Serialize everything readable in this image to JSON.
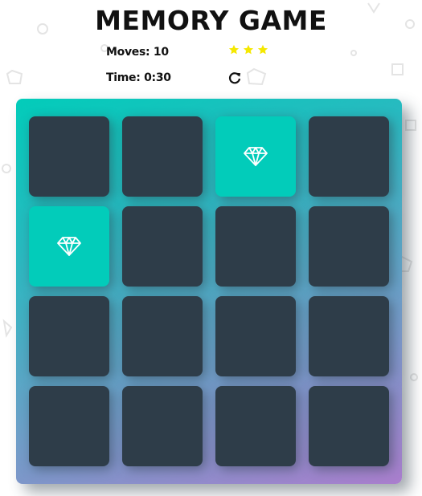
{
  "title": "MEMORY GAME",
  "score_panel": {
    "moves_label": "Moves: 10",
    "time_label": "Time: 0:30",
    "stars_filled": 3,
    "star_icon": "star-icon",
    "restart_icon": "restart-icon",
    "star_color": "#f5e800"
  },
  "deck": {
    "rows": 4,
    "cols": 4,
    "cards": [
      {
        "state": "closed"
      },
      {
        "state": "closed"
      },
      {
        "state": "open",
        "icon": "diamond-icon"
      },
      {
        "state": "closed"
      },
      {
        "state": "open",
        "icon": "diamond-icon"
      },
      {
        "state": "closed"
      },
      {
        "state": "closed"
      },
      {
        "state": "closed"
      },
      {
        "state": "closed"
      },
      {
        "state": "closed"
      },
      {
        "state": "closed"
      },
      {
        "state": "closed"
      },
      {
        "state": "closed"
      },
      {
        "state": "closed"
      },
      {
        "state": "closed"
      },
      {
        "state": "closed"
      }
    ],
    "card_color": "#2e3d49",
    "open_color": "#02ccba"
  }
}
